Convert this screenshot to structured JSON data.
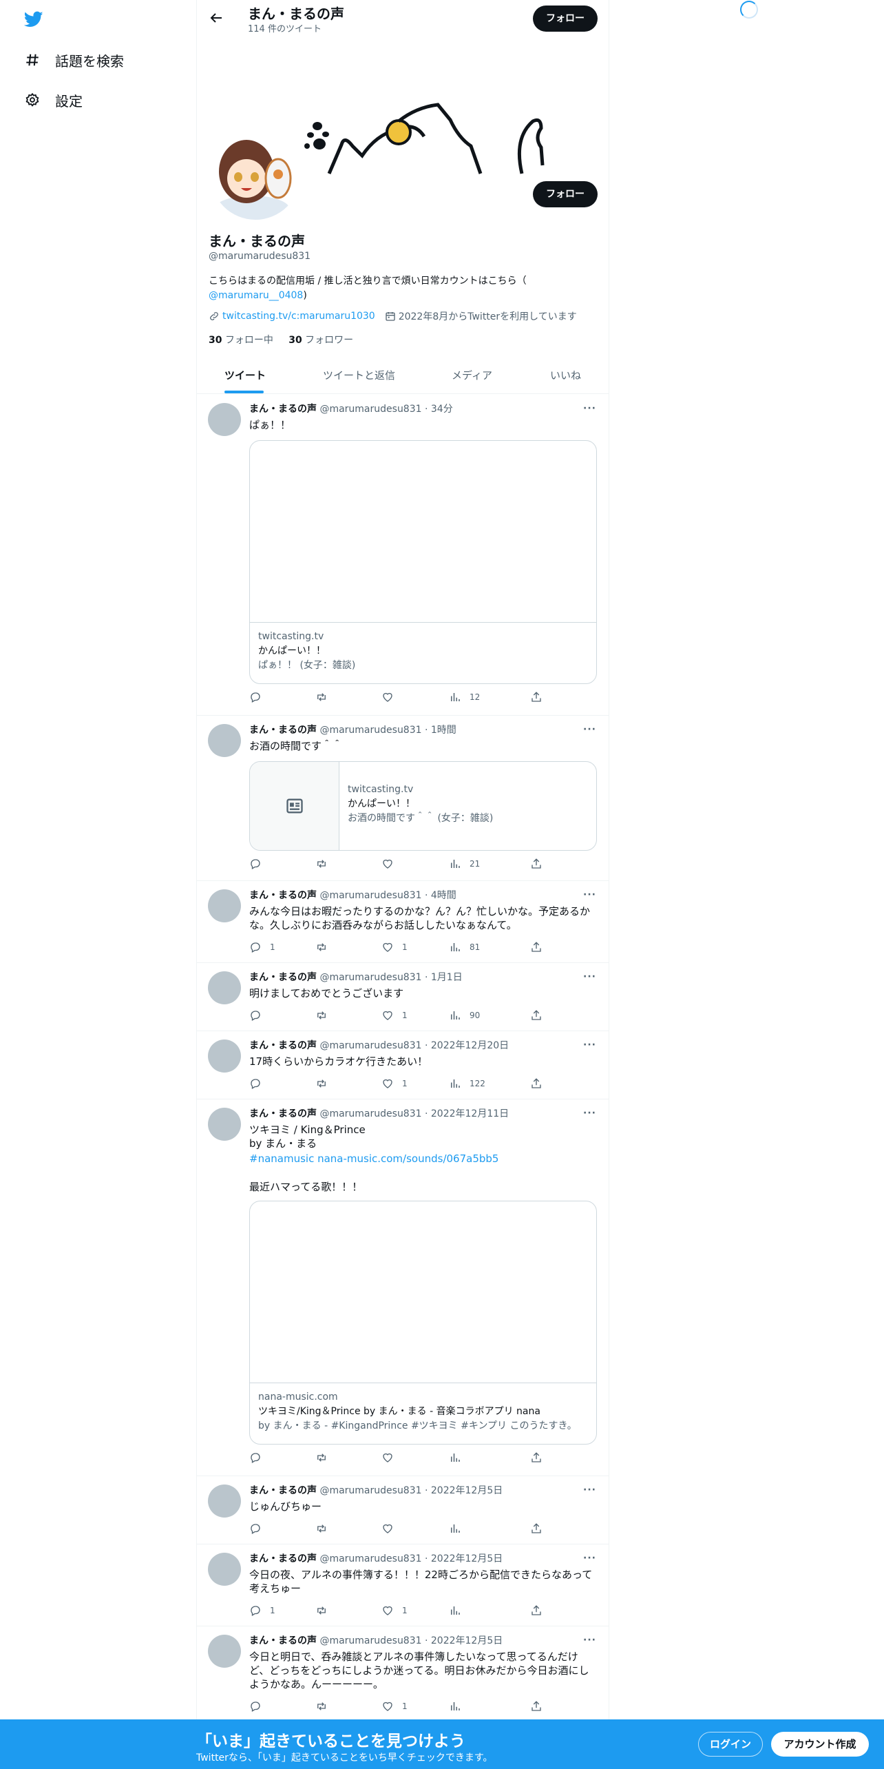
{
  "nav": {
    "explore_label": "話題を検索",
    "settings_label": "設定"
  },
  "header": {
    "title": "まん・まるの声",
    "tweet_count": "114 件のツイート",
    "follow_label": "フォロー"
  },
  "profile": {
    "name": "まん・まるの声",
    "handle": "@marumarudesu831",
    "bio_text": "こちらはまるの配信用垢 / 推し活と独り言で煩い日常カウントはこちら（",
    "bio_mention": "@marumaru__0408",
    "bio_end": ")",
    "url": "twitcasting.tv/c:marumaru1030",
    "joined": "2022年8月からTwitterを利用しています",
    "following_count": "30",
    "following_label": "フォロー中",
    "followers_count": "30",
    "followers_label": "フォロワー",
    "follow_label": "フォロー"
  },
  "tabs": [
    "ツイート",
    "ツイートと返信",
    "メディア",
    "いいね"
  ],
  "tweets": [
    {
      "name": "まん・まるの声",
      "meta": "@marumarudesu831 · 34分",
      "lines": [
        "ぱぁ！！"
      ],
      "card": {
        "domain": "twitcasting.tv",
        "title": "かんぱーい！！",
        "desc": "ぱぁ！！ (女子：雑談)"
      },
      "replies": "",
      "likes": "",
      "views": "12"
    },
    {
      "name": "まん・まるの声",
      "meta": "@marumarudesu831 · 1時間",
      "lines": [
        "お酒の時間です＾＾"
      ],
      "card": {
        "domain": "twitcasting.tv",
        "title": "かんぱーい！！",
        "desc": "お酒の時間です＾＾ (女子：雑談)"
      },
      "replies": "",
      "likes": "",
      "views": "21"
    },
    {
      "name": "まん・まるの声",
      "meta": "@marumarudesu831 · 4時間",
      "lines": [
        "みんな今日はお暇だったりするのかな？ん？ん？忙しいかな。予定あるか",
        "な。久しぶりにお酒呑みながらお話ししたいなぁなんて。"
      ],
      "replies": "1",
      "likes": "1",
      "views": "81"
    },
    {
      "name": "まん・まるの声",
      "meta": "@marumarudesu831 · 1月1日",
      "lines": [
        "明けましておめでとうございます"
      ],
      "replies": "",
      "likes": "1",
      "views": "90"
    },
    {
      "name": "まん・まるの声",
      "meta": "@marumarudesu831 · 2022年12月20日",
      "lines": [
        "17時くらいからカラオケ行きたあい！"
      ],
      "replies": "",
      "likes": "1",
      "views": "122"
    },
    {
      "name": "まん・まるの声",
      "meta": "@marumarudesu831 · 2022年12月11日",
      "lines": [
        "ツキヨミ / King＆Prince",
        "by まん・まる"
      ],
      "link_line": "#nanamusic nana-music.com/sounds/067a5bb5",
      "extra_line": "最近ハマってる歌！！！",
      "card": {
        "domain": "nana-music.com",
        "title": "ツキヨミ/King＆Prince by まん・まる - 音楽コラボアプリ nana",
        "desc": "by まん・まる - #KingandPrince #ツキヨミ #キンプリ このうたすき。"
      },
      "replies": "",
      "likes": "",
      "views": ""
    },
    {
      "name": "まん・まるの声",
      "meta": "@marumarudesu831 · 2022年12月5日",
      "lines": [
        "じゅんびちゅー"
      ],
      "replies": "",
      "likes": "",
      "views": ""
    },
    {
      "name": "まん・まるの声",
      "meta": "@marumarudesu831 · 2022年12月5日",
      "lines": [
        "今日の夜、アルネの事件簿する！！！22時ごろから配信できたらなあって",
        "考えちゅー"
      ],
      "replies": "1",
      "likes": "1",
      "views": ""
    },
    {
      "name": "まん・まるの声",
      "meta": "@marumarudesu831 · 2022年12月5日",
      "lines": [
        "今日と明日で、呑み雑談とアルネの事件簿したいなって思ってるんだけ",
        "ど、どっちをどっちにしようか迷ってる。明日お休みだから今日お酒にし",
        "ようかなあ。んーーーーー。"
      ],
      "replies": "",
      "likes": "1",
      "views": ""
    }
  ],
  "bottom": {
    "title": "「いま」起きていることを見つけよう",
    "subtitle": "Twitterなら、「いま」起きていることをいち早くチェックできます。",
    "login_label": "ログイン",
    "signup_label": "アカウント作成"
  }
}
